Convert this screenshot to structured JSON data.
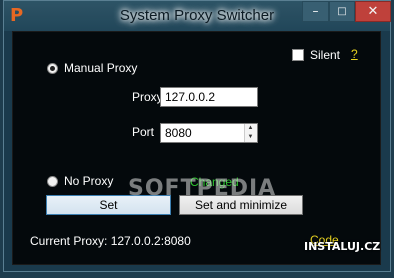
{
  "window": {
    "title": "System Proxy Switcher"
  },
  "options": {
    "silent_label": "Silent",
    "help_link": "?",
    "manual_proxy_label": "Manual Proxy",
    "manual_proxy_selected": true,
    "no_proxy_label": "No Proxy",
    "no_proxy_selected": false
  },
  "fields": {
    "proxy_label": "Proxy",
    "proxy_value": "127.0.0.2",
    "port_label": "Port",
    "port_value": "8080"
  },
  "status": {
    "changed_text": "Changed",
    "current_text": "Current  Proxy: 127.0.0.2:8080",
    "code_link": "Code"
  },
  "buttons": {
    "set_label": "Set",
    "set_minimize_label": "Set and minimize"
  },
  "overlay": {
    "watermark": "SOFTPEDIA",
    "badge": "INSTALUJ.CZ"
  }
}
